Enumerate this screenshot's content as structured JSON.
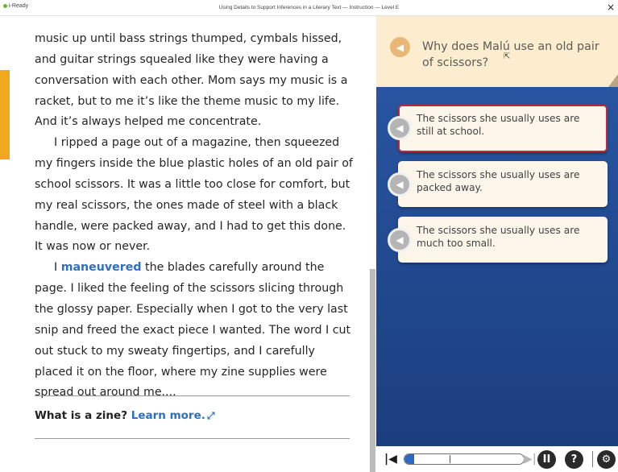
{
  "window": {
    "logo": "i-Ready",
    "title": "Using Details to Support Inferences in a Literary Text — Instruction — Level E",
    "close_label": "×"
  },
  "passage": {
    "para1": "music up until bass strings thumped, cymbals hissed, and guitar strings squealed like they were having a conversation with each other. Mom says my music is a racket, but to me it’s like the theme music to my life. And it’s always helped me concentrate.",
    "para2": "I ripped a page out of a magazine, then squeezed my fingers inside the blue plastic holes of an old pair of school scissors. It was a little too close for comfort, but my real scissors, the ones made of steel with a black handle, were packed away, and I had to get this done. It was now or never.",
    "para3_pre": "I ",
    "vocab_word": "maneuvered",
    "para3_post": " the blades carefully around the page. I liked the feeling of the scissors slicing through the glossy paper. Especially when I got to the very last snip and freed the exact piece I wanted. The word I cut out stuck to my sweaty fingertips, and I carefully placed it on the floor, where my zine supplies were spread out around me...."
  },
  "zine": {
    "question": "What is a zine? ",
    "link": "Learn more."
  },
  "question": {
    "text": "Why does Malú use an old pair of scissors?"
  },
  "choices": [
    {
      "text": "The scissors she usually uses are still at school.",
      "selected": true
    },
    {
      "text": "The scissors she usually uses are packed away.",
      "selected": false
    },
    {
      "text": "The scissors she usually uses are much too small.",
      "selected": false
    }
  ],
  "controls": {
    "progress_fraction": 0.08,
    "pause_glyph": "II",
    "help_glyph": "?",
    "settings_glyph": "⚙"
  },
  "colors": {
    "accent_orange": "#f2a81d",
    "link_blue": "#2e6fc0",
    "panel_blue": "#2b59a8",
    "selected_border": "#c0283e",
    "question_bg": "#fbedce"
  },
  "icons": {
    "question_audio": "speaker-icon",
    "choice_audio": "speaker-icon",
    "expand": "expand-arrows-icon",
    "prev": "skip-back-icon",
    "next": "skip-forward-icon",
    "pause": "pause-icon",
    "help": "help-icon",
    "settings": "gear-icon"
  }
}
